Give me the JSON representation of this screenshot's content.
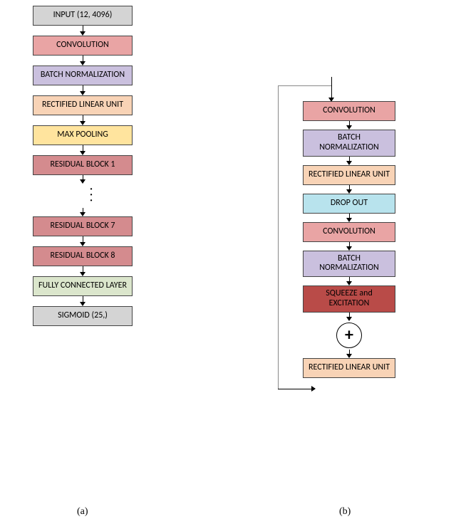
{
  "col_a": {
    "input": "INPUT (12, 4096)",
    "conv": "CONVOLUTION",
    "bn": "BATCH NORMALIZATION",
    "relu": "RECTIFIED LINEAR UNIT",
    "pool": "MAX POOLING",
    "res1": "RESIDUAL BLOCK 1",
    "res7": "RESIDUAL BLOCK 7",
    "res8": "RESIDUAL BLOCK 8",
    "fc": "FULLY CONNECTED LAYER",
    "sigmoid": "SIGMOID (25,)"
  },
  "col_b": {
    "conv1": "CONVOLUTION",
    "bn1": "BATCH NORMALIZATION",
    "relu1": "RECTIFIED LINEAR UNIT",
    "drop": "DROP OUT",
    "conv2": "CONVOLUTION",
    "bn2": "BATCH NORMALIZATION",
    "se": "SQUEEZE and EXCITATION",
    "plus": "+",
    "relu2": "RECTIFIED LINEAR UNIT"
  },
  "captions": {
    "a": "(a)",
    "b": "(b)"
  }
}
